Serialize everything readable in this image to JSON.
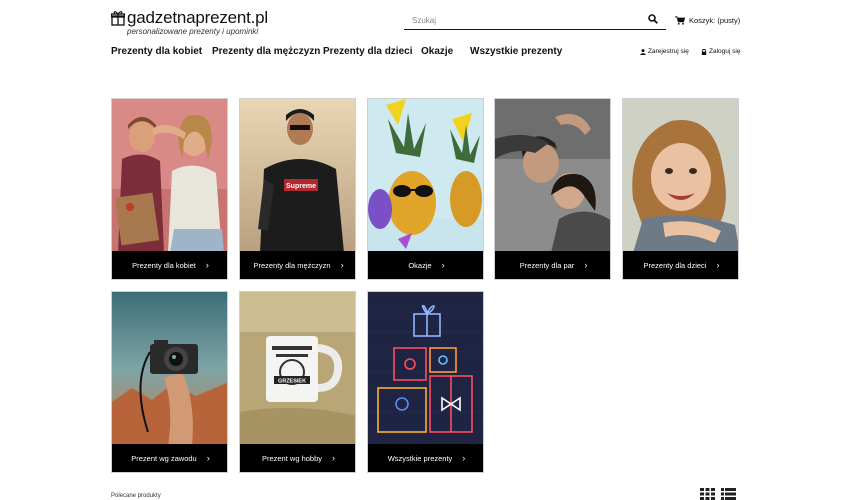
{
  "header": {
    "logo_text": "gadzetnaprezent.pl",
    "logo_tagline": "personalizowane prezenty i upominki",
    "search_placeholder": "Szukaj",
    "cart_label": "Koszyk: (pusty)"
  },
  "nav": {
    "items": [
      {
        "label": "Prezenty dla kobiet"
      },
      {
        "label": "Prezenty dla mężczyzn"
      },
      {
        "label": "Prezenty dla dzieci"
      },
      {
        "label": "Okazje"
      },
      {
        "label": "Wszystkie prezenty"
      }
    ],
    "register_label": "Zarejestruj się",
    "login_label": "Zaloguj się"
  },
  "tiles": [
    {
      "label": "Prezenty dla kobiet"
    },
    {
      "label": "Prezenty dla mężczyzn"
    },
    {
      "label": "Okazje"
    },
    {
      "label": "Prezenty dla par"
    },
    {
      "label": "Prezenty dla dzieci"
    },
    {
      "label": "Prezent wg zawodu"
    },
    {
      "label": "Prezent wg hobby"
    },
    {
      "label": "Wszystkie prezenty"
    }
  ],
  "tile_art": {
    "mug_text": "GRZESIEK",
    "shirt_text": "Supreme"
  },
  "footer": {
    "recommended_label": "Polecane produkty"
  },
  "icons": {
    "cart": "cart-icon",
    "search": "search-icon",
    "user": "user-icon",
    "lock": "lock-icon",
    "chevron": "chevron-right-icon",
    "grid_view": "grid-view-icon",
    "list_view": "list-view-icon"
  },
  "colors": {
    "accent": "#000000",
    "tile_bar": "#000000",
    "text": "#111111"
  }
}
